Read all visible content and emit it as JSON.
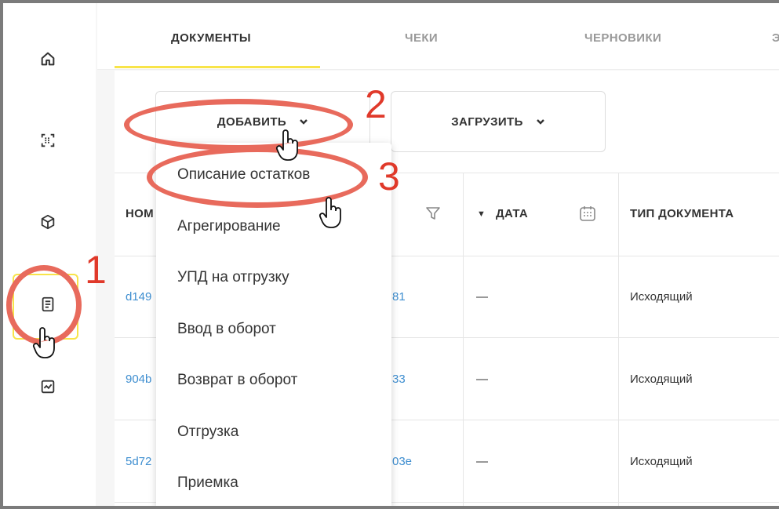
{
  "tabs": [
    "ДОКУМЕНТЫ",
    "ЧЕКИ",
    "ЧЕРНОВИКИ",
    "Э"
  ],
  "buttons": {
    "add": "ДОБАВИТЬ",
    "upload": "ЗАГРУЗИТЬ",
    "chevron": "⌄"
  },
  "table": {
    "headers": {
      "number": "НОМ",
      "date": "ДАТА",
      "doc_type": "ТИП ДОКУМЕНТА"
    },
    "rows": [
      {
        "id_left": "d149",
        "id_right": "81",
        "date": "—",
        "type": "Исходящий"
      },
      {
        "id_left": "904b",
        "id_right": "33",
        "date": "—",
        "type": "Исходящий"
      },
      {
        "id_left": "5d72",
        "id_right": "03e",
        "date": "—",
        "type": "Исходящий"
      }
    ]
  },
  "dropdown": [
    "Описание остатков",
    "Агрегирование",
    "УПД на отгрузку",
    "Ввод в оборот",
    "Возврат в оборот",
    "Отгрузка",
    "Приемка"
  ],
  "annotations": [
    "1",
    "2",
    "3"
  ],
  "colors": {
    "accent": "#f8e449",
    "annotation": "#e86a5c",
    "link": "#3e8ed0"
  }
}
